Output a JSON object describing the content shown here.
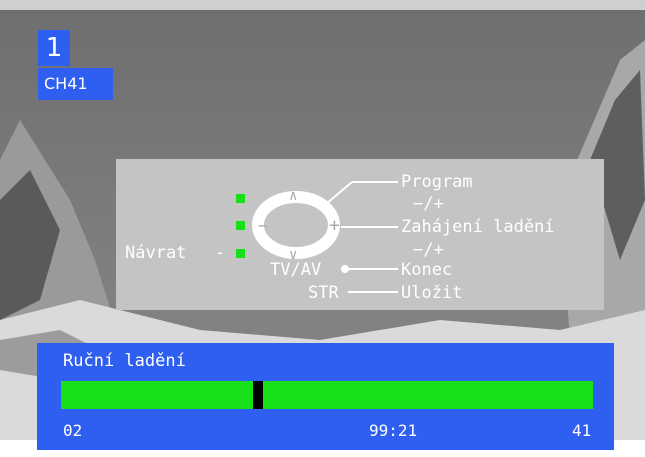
{
  "channel": {
    "number": "1",
    "label": "CH41"
  },
  "help_menu": {
    "program": "Program",
    "program_keys": "−/+",
    "start_tuning": "Zahájení ladění",
    "tuning_keys": "−/+",
    "back": "Návrat",
    "back_dash": "-",
    "tvav": "TV/AV",
    "end": "Konec",
    "str": "STR",
    "save": "Uložit",
    "remote_symbols": {
      "up": "∧",
      "down": "∨",
      "minus": "−",
      "plus": "+"
    }
  },
  "tuning_bar": {
    "title": "Ruční ladění",
    "left_value": "02",
    "center_value": "99:21",
    "right_value": "41",
    "progress_fraction": 0.37
  },
  "colors": {
    "accent_blue": "#2f5ff0",
    "indicator_green": "#18e018",
    "panel_gray": "#c4c4c4"
  }
}
